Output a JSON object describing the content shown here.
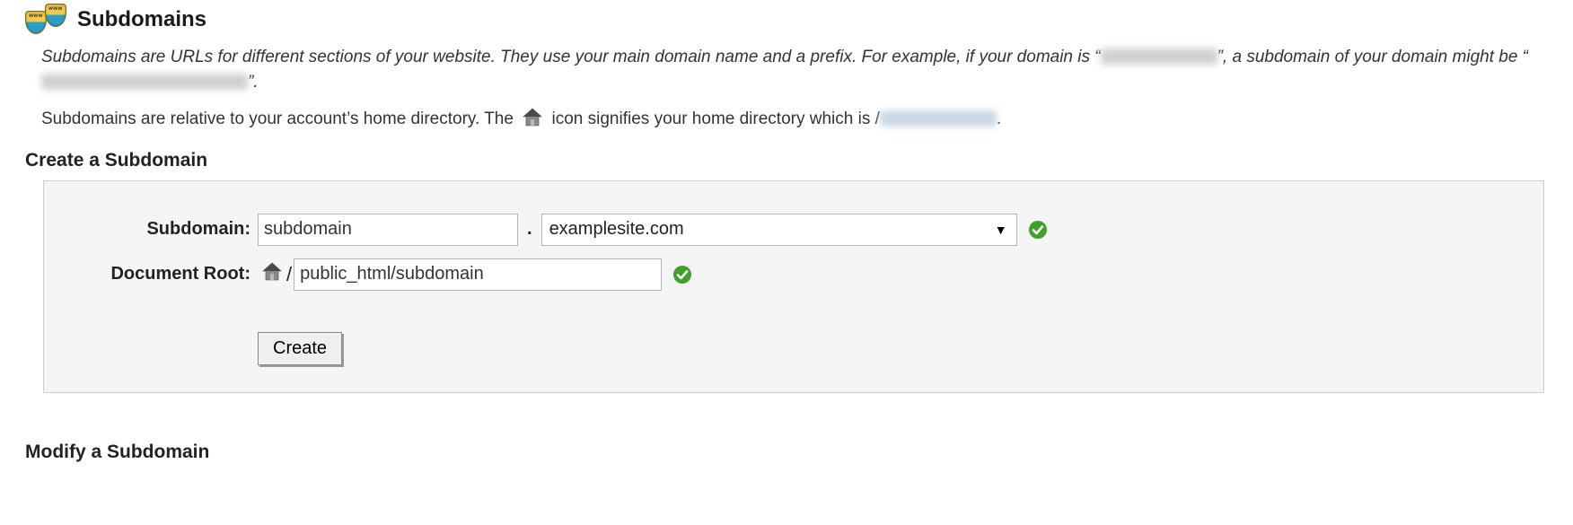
{
  "header": {
    "title": "Subdomains"
  },
  "intro": {
    "text1a": "Subdomains are URLs for different sections of your website. They use your main domain name and a prefix. For example, if your domain is “",
    "text1b": "”, a subdomain of your domain might be “",
    "text1c": "”.",
    "text2a": "Subdomains are relative to your account’s home directory. The ",
    "text2b": " icon signifies your home directory which is /",
    "text2c": "."
  },
  "create": {
    "section_title": "Create a Subdomain",
    "subdomain_label": "Subdomain:",
    "subdomain_value": "subdomain",
    "dot": ".",
    "domain_value": "examplesite.com",
    "docroot_label": "Document Root:",
    "docroot_slash": "/",
    "docroot_value": "public_html/subdomain",
    "create_button": "Create"
  },
  "modify": {
    "section_title": "Modify a Subdomain"
  }
}
